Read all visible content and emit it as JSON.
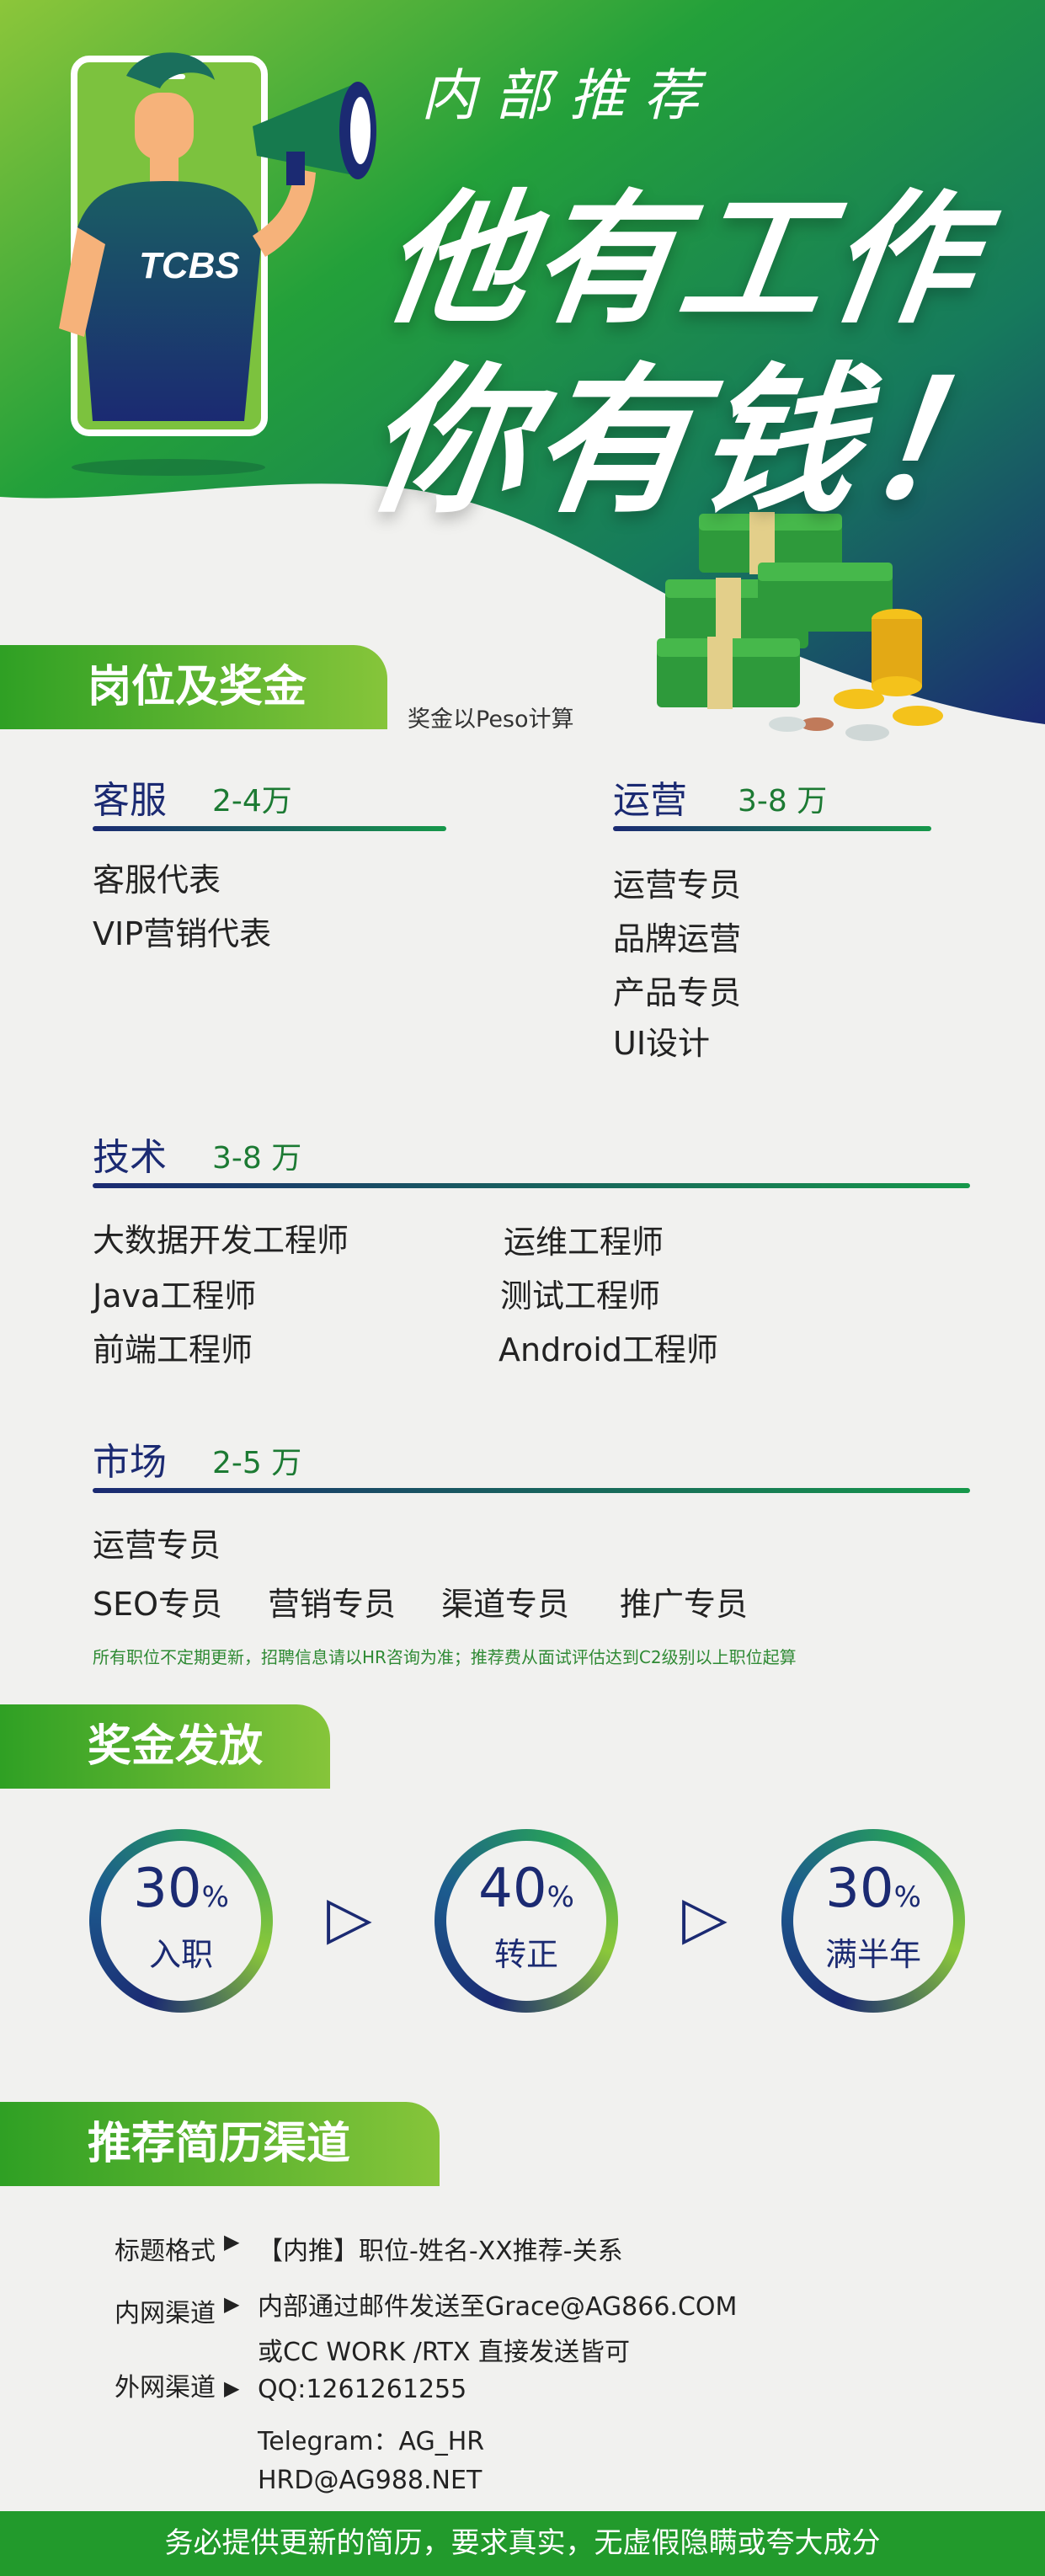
{
  "hero": {
    "subtitle": "内部推荐",
    "line1": "他有工作",
    "line2": "你有钱！",
    "shirt_text": "TCBS"
  },
  "positions": {
    "header": "岗位及奖金",
    "note": "奖金以Peso计算",
    "categories": {
      "cs": {
        "title": "客服",
        "range": "2-4万",
        "items": [
          "客服代表",
          "VIP营销代表"
        ]
      },
      "ops": {
        "title": "运营",
        "range": "3-8 万",
        "items": [
          "运营专员",
          "品牌运营",
          "产品专员",
          "UI设计"
        ]
      },
      "tech": {
        "title": "技术",
        "range": "3-8 万",
        "items": [
          "大数据开发工程师",
          "运维工程师",
          "Java工程师",
          "测试工程师",
          "前端工程师",
          "Android工程师"
        ]
      },
      "market": {
        "title": "市场",
        "range": "2-5 万",
        "items": [
          "运营专员",
          "SEO专员",
          "营销专员",
          "渠道专员",
          "推广专员"
        ]
      }
    },
    "footnote": "所有职位不定期更新，招聘信息请以HR咨询为准；推荐费从面试评估达到C2级别以上职位起算"
  },
  "payout": {
    "header": "奖金发放",
    "stages": [
      {
        "percent": "30",
        "unit": "%",
        "label": "入职"
      },
      {
        "percent": "40",
        "unit": "%",
        "label": "转正"
      },
      {
        "percent": "30",
        "unit": "%",
        "label": "满半年"
      }
    ],
    "arrow": "▷"
  },
  "channels": {
    "header": "推荐简历渠道",
    "marker": "▶",
    "title_format_label": "标题格式",
    "title_format_value": "【内推】职位-姓名-XX推荐-关系",
    "intranet_label": "内网渠道",
    "intranet_line1": "内部通过邮件发送至Grace@AG866.COM",
    "intranet_line2": "或CC WORK /RTX 直接发送皆可",
    "external_label": "外网渠道",
    "external_qq": "QQ:1261261255",
    "external_telegram": "Telegram：AG_HR",
    "external_email": "HRD@AG988.NET"
  },
  "footer": "务必提供更新的简历，要求真实，无虚假隐瞒或夸大成分",
  "colors": {
    "green": "#2fa024",
    "navy": "#1b2a72",
    "lime": "#8bc83a"
  }
}
